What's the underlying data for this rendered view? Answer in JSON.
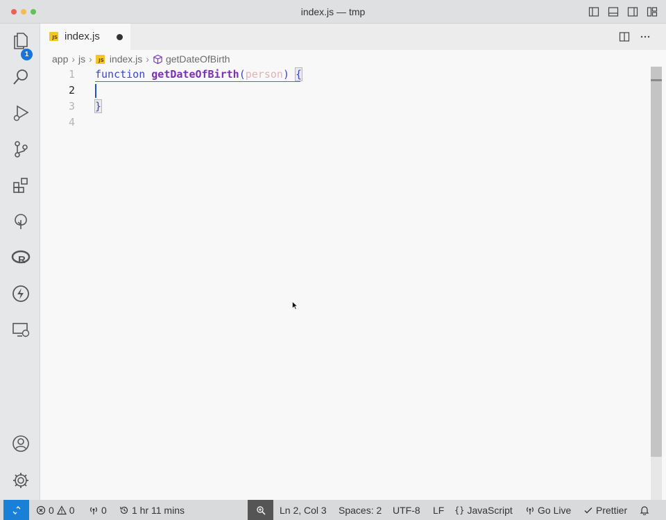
{
  "window": {
    "title": "index.js — tmp"
  },
  "activity_bar": {
    "explorer_badge": "1"
  },
  "tab": {
    "label": "index.js",
    "icon": "js-file-icon"
  },
  "breadcrumbs": {
    "items": [
      "app",
      "js",
      "index.js",
      "getDateOfBirth"
    ]
  },
  "editor": {
    "line_numbers": [
      "1",
      "2",
      "3",
      "4"
    ],
    "line1": {
      "keyword": "function",
      "fn_name": "getDateOfBirth",
      "open_paren": "(",
      "param": "person",
      "close_paren": ")",
      "open_brace": "{"
    },
    "line3": {
      "close_brace": "}"
    }
  },
  "status_bar": {
    "errors": "0",
    "warnings": "0",
    "ports": "0",
    "time": "1 hr 11 mins",
    "position": "Ln 2, Col 3",
    "spaces": "Spaces: 2",
    "encoding": "UTF-8",
    "eol": "LF",
    "language": "JavaScript",
    "go_live": "Go Live",
    "prettier": "Prettier"
  },
  "colors": {
    "accent": "#1a7fd6",
    "keyword": "#3a46c6",
    "function": "#7b2fb5",
    "parameter": "#e1b3b7"
  }
}
